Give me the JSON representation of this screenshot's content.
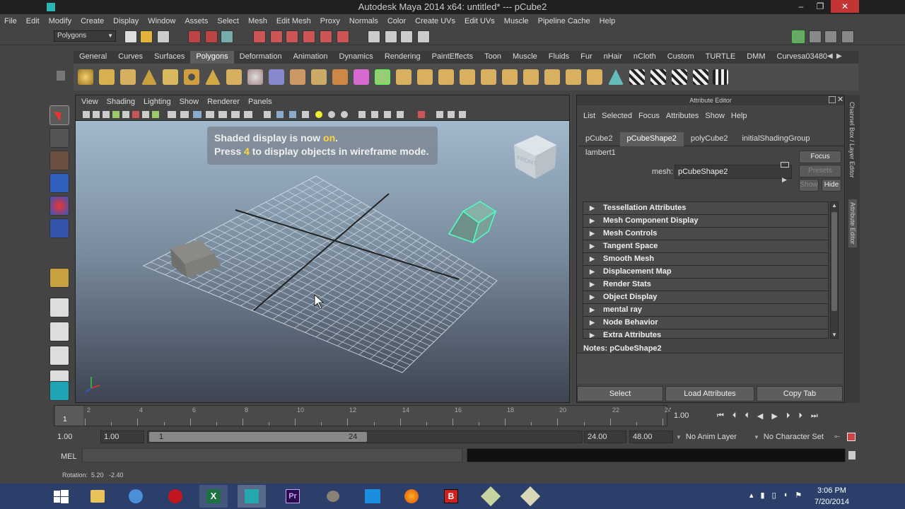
{
  "window": {
    "title": "Autodesk Maya 2014 x64: untitled*   ---   pCube2"
  },
  "menubar": [
    "File",
    "Edit",
    "Modify",
    "Create",
    "Display",
    "Window",
    "Assets",
    "Select",
    "Mesh",
    "Edit Mesh",
    "Proxy",
    "Normals",
    "Color",
    "Create UVs",
    "Edit UVs",
    "Muscle",
    "Pipeline Cache",
    "Help"
  ],
  "statusline": {
    "mode": "Polygons"
  },
  "shelf": {
    "tabs": [
      "General",
      "Curves",
      "Surfaces",
      "Polygons",
      "Deformation",
      "Animation",
      "Dynamics",
      "Rendering",
      "PaintEffects",
      "Toon",
      "Muscle",
      "Fluids",
      "Fur",
      "nHair",
      "nCloth",
      "Custom",
      "TURTLE",
      "DMM",
      "Curvesa03480"
    ],
    "active": "Polygons"
  },
  "viewport": {
    "menu": [
      "View",
      "Shading",
      "Lighting",
      "Show",
      "Renderer",
      "Panels"
    ],
    "hud": {
      "line1_pre": "Shaded display is now ",
      "line1_on": "on",
      "line1_post": ".",
      "line2_pre": "Press ",
      "line2_key": "4",
      "line2_post": " to display objects in wireframe mode."
    },
    "viewcube_label": "FRONT"
  },
  "attribute_editor": {
    "title": "Attribute Editor",
    "menu": [
      "List",
      "Selected",
      "Focus",
      "Attributes",
      "Show",
      "Help"
    ],
    "tabs": [
      "pCube2",
      "pCubeShape2",
      "polyCube2",
      "initialShadingGroup",
      "lambert1"
    ],
    "active_tab": "pCubeShape2",
    "mesh_label": "mesh:",
    "mesh_value": "pCubeShape2",
    "focus_btn": "Focus",
    "presets_btn": "Presets",
    "show_btn": "Show",
    "hide_btn": "Hide",
    "sections": [
      "Tessellation Attributes",
      "Mesh Component Display",
      "Mesh Controls",
      "Tangent Space",
      "Smooth Mesh",
      "Displacement Map",
      "Render Stats",
      "Object Display",
      "mental ray",
      "Node Behavior",
      "Extra Attributes"
    ],
    "notes_label": "Notes:",
    "notes_value": "pCubeShape2",
    "buttons": {
      "select": "Select",
      "load": "Load Attributes",
      "copy": "Copy Tab"
    }
  },
  "side_tabs": {
    "channel": "Channel Box / Layer Editor",
    "attr": "Attribute Editor"
  },
  "timeline": {
    "ticks": [
      "2",
      "4",
      "6",
      "8",
      "10",
      "12",
      "14",
      "16",
      "18",
      "20",
      "22",
      "24"
    ],
    "current_frame": "1",
    "current_field": "1.00"
  },
  "range": {
    "start": "1.00",
    "start2": "1.00",
    "slider_start": "1",
    "slider_end": "24",
    "end": "24.00",
    "end2": "48.00",
    "anim_layer": "No Anim Layer",
    "char_set": "No Character Set"
  },
  "commandline": {
    "label": "MEL"
  },
  "helpline": {
    "text": "Rotation:  5.20   -2.40"
  },
  "taskbar": {
    "time": "3:06 PM",
    "date": "7/20/2014"
  }
}
